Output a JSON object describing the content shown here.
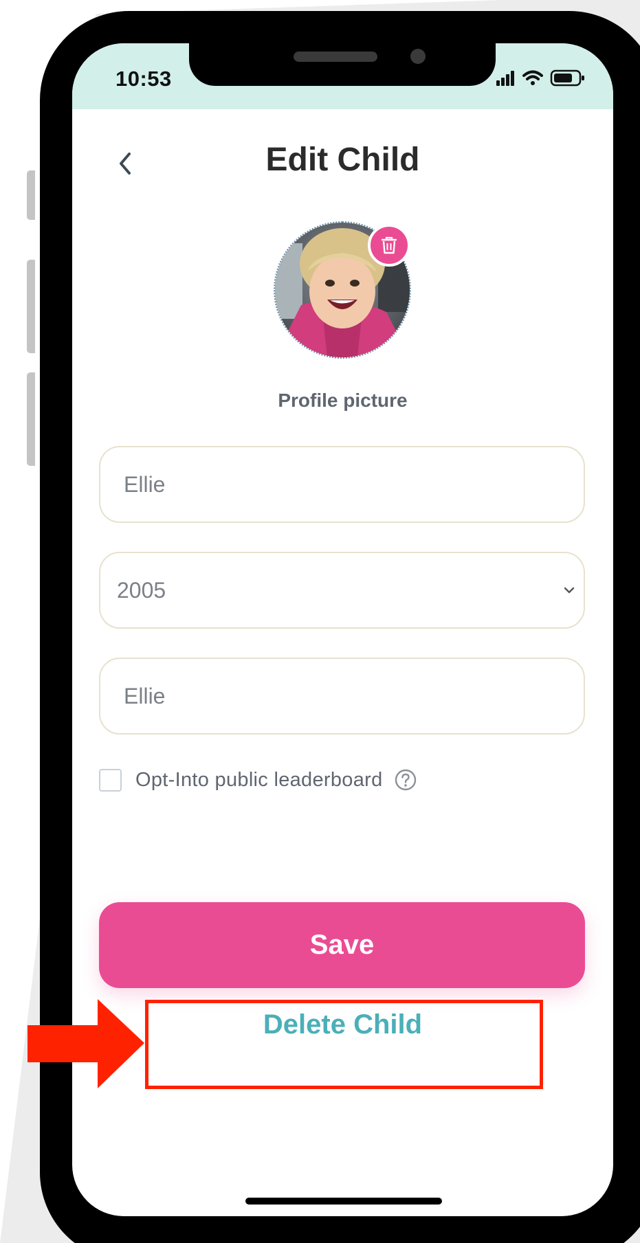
{
  "status_bar": {
    "time": "10:53",
    "background": "#d2efe9",
    "icons": [
      "cellular-signal-icon",
      "wifi-icon",
      "battery-icon"
    ]
  },
  "header": {
    "title": "Edit Child",
    "back_icon": "chevron-left-icon"
  },
  "profile": {
    "label": "Profile picture",
    "delete_photo_icon": "trash-icon"
  },
  "form": {
    "name": {
      "value": "Ellie"
    },
    "birth_year": {
      "value": "2005",
      "icon": "chevron-down-icon"
    },
    "display_name": {
      "value": "Ellie"
    },
    "leaderboard": {
      "label": "Opt-Into public leaderboard",
      "checked": false,
      "help_icon": "question-circle-icon"
    }
  },
  "actions": {
    "save_label": "Save",
    "delete_label": "Delete Child"
  },
  "annotation": {
    "color": "#ff2200"
  },
  "colors": {
    "primary": "#ea4c93",
    "secondary_text": "#4bafb8",
    "title": "#2b2b2b",
    "field_border": "#e6e2cf"
  }
}
